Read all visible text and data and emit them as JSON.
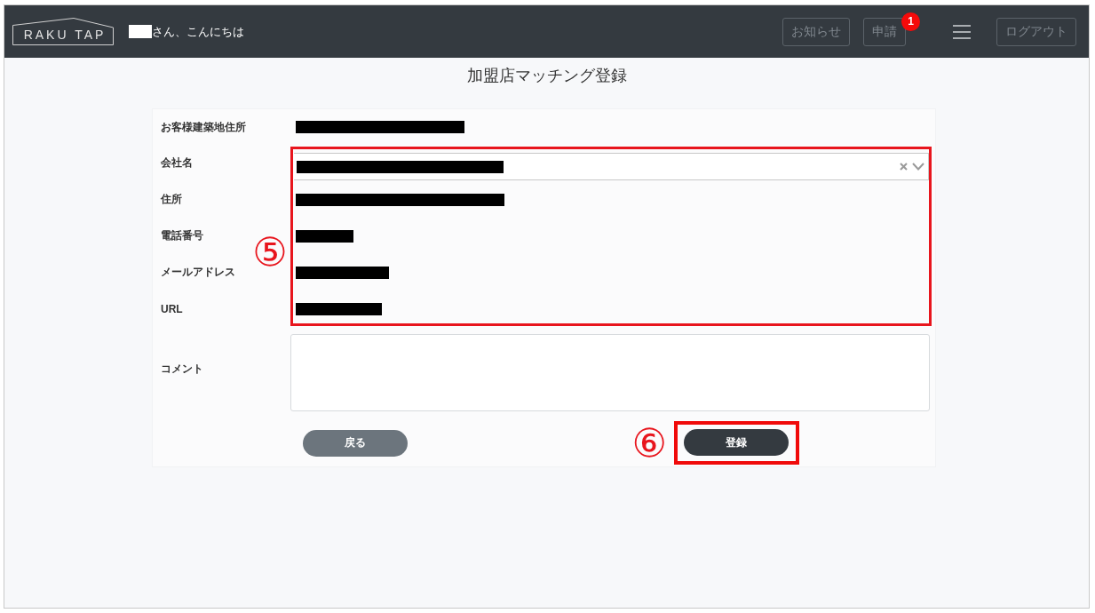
{
  "header": {
    "logo": "RAKU TAP",
    "greeting": {
      "name_redacted": true,
      "text": "さん、こんにちは"
    },
    "nav": [
      {
        "kind": "button",
        "label": "お知らせ"
      },
      {
        "kind": "button",
        "label": "申請",
        "badge": "1"
      },
      {
        "kind": "menu"
      },
      {
        "kind": "button",
        "label": "ログアウト"
      }
    ]
  },
  "page_title": "加盟店マッチング登録",
  "form": {
    "rows": [
      {
        "label": "お客様建築地住所",
        "kind": "text",
        "redacted": true,
        "highlighted": false
      },
      {
        "label": "会社名",
        "kind": "select",
        "redacted": true,
        "highlighted": true
      },
      {
        "label": "住所",
        "kind": "text",
        "redacted": true,
        "highlighted": true
      },
      {
        "label": "電話番号",
        "kind": "text",
        "redacted": true,
        "highlighted": true
      },
      {
        "label": "メールアドレス",
        "kind": "text",
        "redacted": true,
        "highlighted": true
      },
      {
        "label": "URL",
        "kind": "text",
        "redacted": true,
        "highlighted": true
      },
      {
        "label": "コメント",
        "kind": "textarea",
        "highlighted": false
      }
    ],
    "highlight_marker": "⑤",
    "buttons": [
      {
        "label": "戻る",
        "kind": "secondary",
        "highlighted": false
      },
      {
        "label": "登録",
        "kind": "primary",
        "highlighted": true,
        "marker": "⑥"
      }
    ]
  }
}
